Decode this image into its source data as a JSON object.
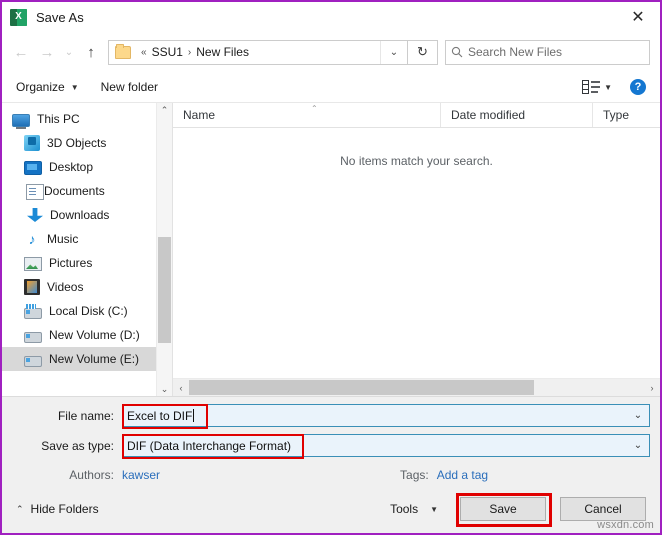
{
  "window": {
    "title": "Save As",
    "app_icon": "excel-icon",
    "close_label": "✕",
    "border_color": "#a020c0"
  },
  "nav": {
    "back": "←",
    "forward": "→",
    "recent": "⌄",
    "up": "↑",
    "breadcrumb": {
      "prefix": "«",
      "items": [
        "SSU1",
        "New Files"
      ],
      "separator": "›"
    },
    "address_caret": "⌄",
    "refresh_icon": "↻"
  },
  "search": {
    "placeholder": "Search New Files",
    "icon": "search-icon"
  },
  "toolbar": {
    "organize": "Organize",
    "organize_caret": "▼",
    "new_folder": "New folder",
    "view_icon": "view-layout-icon",
    "view_caret": "▼",
    "help": "?"
  },
  "sidebar": {
    "items": [
      {
        "label": "This PC",
        "icon": "computer-icon",
        "root": true,
        "selected": false
      },
      {
        "label": "3D Objects",
        "icon": "3d-objects-icon",
        "root": false,
        "selected": false
      },
      {
        "label": "Desktop",
        "icon": "desktop-icon",
        "root": false,
        "selected": false
      },
      {
        "label": "Documents",
        "icon": "documents-icon",
        "root": false,
        "selected": false
      },
      {
        "label": "Downloads",
        "icon": "downloads-icon",
        "root": false,
        "selected": false
      },
      {
        "label": "Music",
        "icon": "music-icon",
        "root": false,
        "selected": false
      },
      {
        "label": "Pictures",
        "icon": "pictures-icon",
        "root": false,
        "selected": false
      },
      {
        "label": "Videos",
        "icon": "videos-icon",
        "root": false,
        "selected": false
      },
      {
        "label": "Local Disk (C:)",
        "icon": "local-disk-icon",
        "root": false,
        "selected": false
      },
      {
        "label": "New Volume (D:)",
        "icon": "drive-icon",
        "root": false,
        "selected": false
      },
      {
        "label": "New Volume (E:)",
        "icon": "drive-icon",
        "root": false,
        "selected": true
      }
    ],
    "scroll_up": "⌃",
    "scroll_down": "⌄"
  },
  "file_list": {
    "columns": [
      "Name",
      "Date modified",
      "Type"
    ],
    "sort_indicator": "⌃",
    "empty_message": "No items match your search.",
    "rows": [],
    "hscroll_left": "‹",
    "hscroll_right": "›"
  },
  "form": {
    "file_name_label": "File name:",
    "file_name_value": "Excel to DIF",
    "save_as_type_label": "Save as type:",
    "save_as_type_value": "DIF (Data Interchange Format)",
    "combo_caret": "⌄",
    "authors_label": "Authors:",
    "authors_value": "kawser",
    "tags_label": "Tags:",
    "tags_value": "Add a tag",
    "highlight_color": "#e00000"
  },
  "footer": {
    "hide_folders": "Hide Folders",
    "hide_folders_caret": "⌃",
    "tools": "Tools",
    "tools_caret": "▼",
    "save": "Save",
    "cancel": "Cancel"
  },
  "watermark": "wsxdn.com"
}
